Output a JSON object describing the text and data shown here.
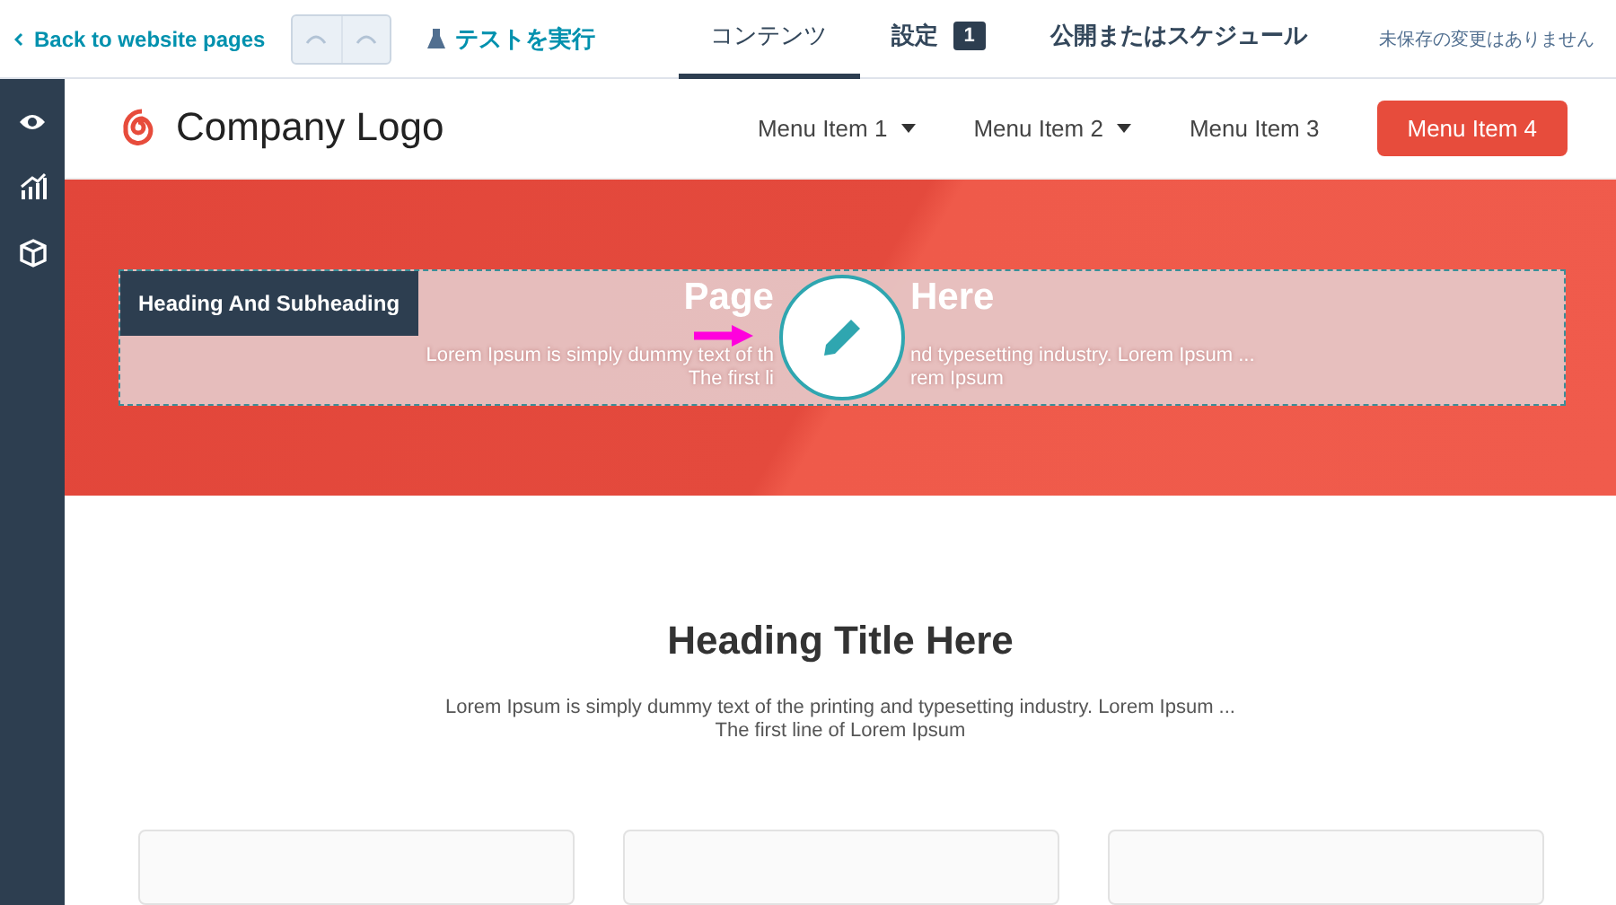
{
  "toolbar": {
    "back_link": "Back to website pages",
    "undo_enabled": false,
    "redo_enabled": false,
    "test_button": "テストを実行",
    "tabs": [
      {
        "label": "コンテンツ",
        "selected": true
      },
      {
        "label": "設定",
        "selected": false,
        "badge": "1"
      },
      {
        "label": "公開またはスケジュール",
        "selected": false
      }
    ],
    "save_status": "未保存の変更はありません"
  },
  "sidebar": {
    "items": [
      {
        "kind": "eye",
        "selected": false
      },
      {
        "kind": "chart",
        "selected": false
      },
      {
        "kind": "box",
        "selected": false
      }
    ]
  },
  "site": {
    "logo": "Company Logo",
    "menu": [
      {
        "label": "Menu Item 1",
        "dropdown": true,
        "primary": false
      },
      {
        "label": "Menu Item 2",
        "dropdown": true,
        "primary": false
      },
      {
        "label": "Menu Item 3",
        "dropdown": false,
        "primary": false
      },
      {
        "label": "Menu Item 4",
        "dropdown": false,
        "primary": true
      }
    ],
    "hero": {
      "module_label": "Heading And Subheading",
      "title_parts": [
        "Page",
        "Here"
      ],
      "text_parts": [
        "Lorem Ipsum is simply dummy text of th",
        "nd typesetting industry. Lorem Ipsum ..."
      ],
      "line2_parts": [
        "The first li",
        "rem Ipsum"
      ]
    },
    "section": {
      "title": "Heading Title Here",
      "text": "Lorem Ipsum is simply dummy text of the printing and typesetting industry. Lorem Ipsum ...",
      "text_line2": "The first line of Lorem Ipsum"
    }
  }
}
